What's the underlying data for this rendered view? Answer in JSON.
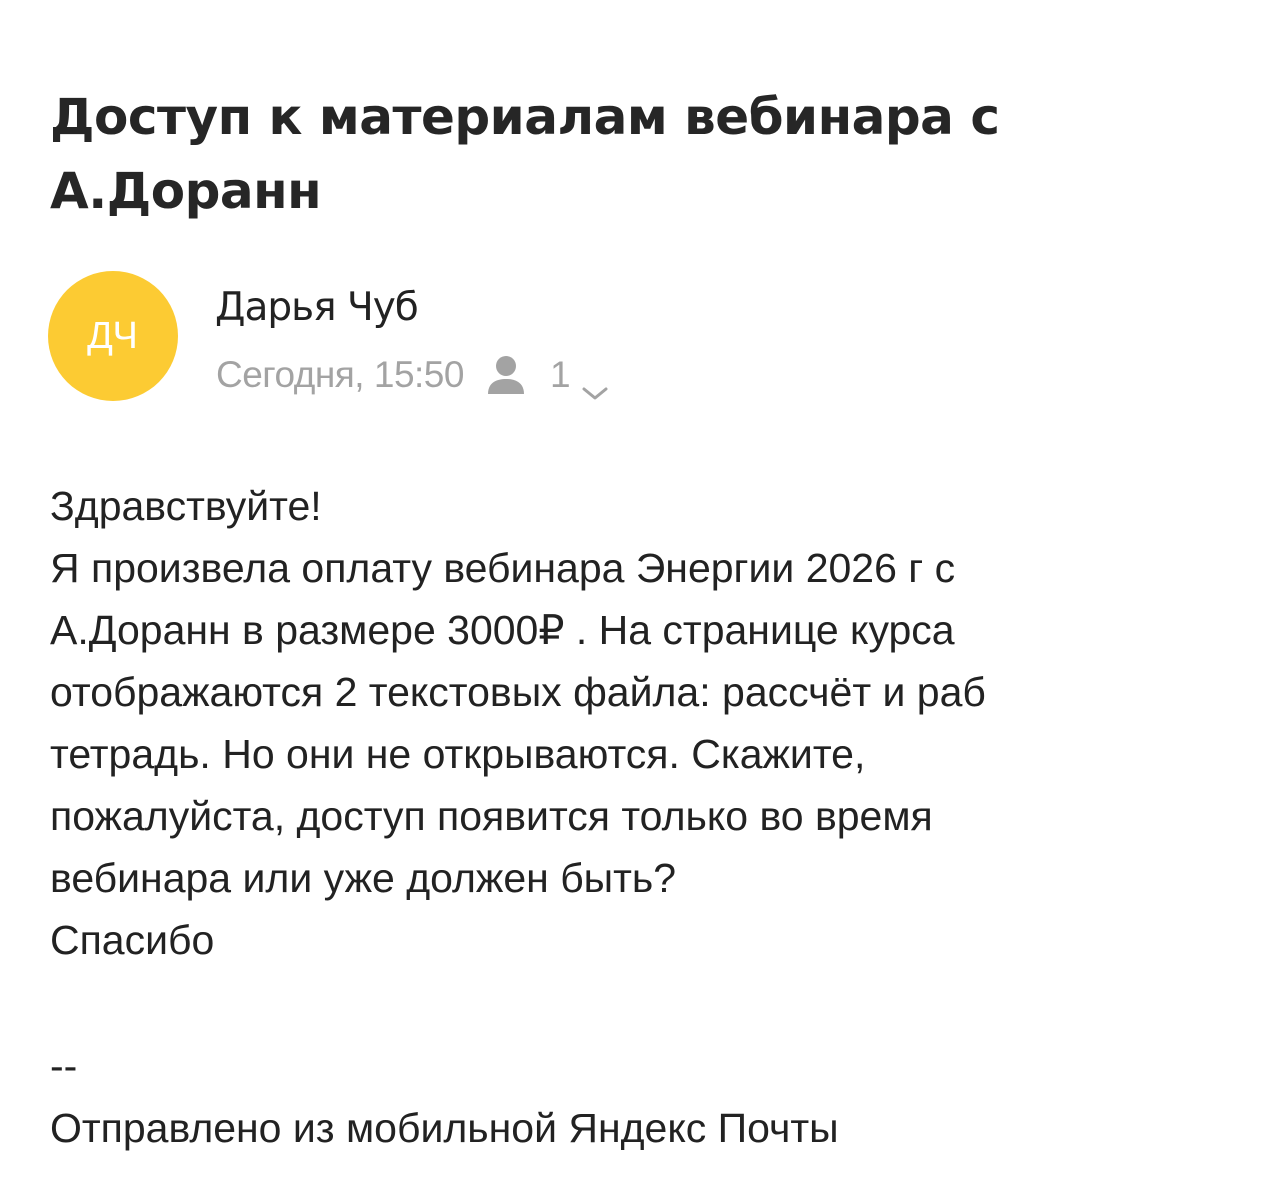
{
  "message": {
    "subject": "Доступ к материалам вебинара с А.Доранн",
    "sender": {
      "initials": "ДЧ",
      "name": "Дарья Чуб",
      "avatar_color": "#fccb33"
    },
    "date": "Сегодня, 15:50",
    "recipients_icon": "person-icon",
    "recipients_count": "1",
    "expand_icon": "chevron-down-icon",
    "body_lines": [
      "Здравствуйте!",
      "Я произвела оплату вебинара Энергии 2026 г с",
      "А.Доранн в размере 3000₽ . На странице курса",
      "отображаются 2 текстовых файла: рассчёт и раб",
      "тетрадь. Но они не открываются. Скажите,",
      "пожалуйста, доступ появится только во время",
      "вебинара или уже должен быть?",
      "Спасибо"
    ],
    "signature_separator": "--",
    "signature": "Отправлено из мобильной Яндекс Почты"
  }
}
